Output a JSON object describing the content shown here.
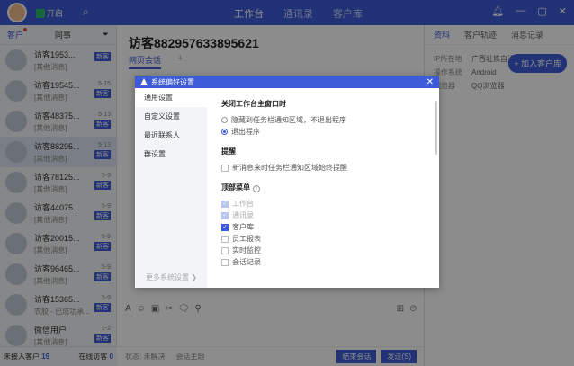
{
  "topbar": {
    "status": "开启",
    "nav": [
      "工作台",
      "通讯录",
      "客户库"
    ],
    "controls": [
      "—",
      "▢",
      "✕"
    ]
  },
  "left": {
    "tabs": [
      "客户",
      "同事"
    ],
    "conversations": [
      {
        "name": "访客1953...",
        "sub": "[其他消息]",
        "date": "",
        "badge": "新客"
      },
      {
        "name": "访客19545...",
        "sub": "[其他消息]",
        "date": "5-15",
        "badge": "新客"
      },
      {
        "name": "访客48375...",
        "sub": "[其他消息]",
        "date": "5-13",
        "badge": "新客"
      },
      {
        "name": "访客88295...",
        "sub": "[其他消息]",
        "date": "5-13",
        "badge": "新客"
      },
      {
        "name": "访客78125...",
        "sub": "[其他消息]",
        "date": "5-9",
        "badge": "新客"
      },
      {
        "name": "访客44075...",
        "sub": "[其他消息]",
        "date": "5-9",
        "badge": "新客"
      },
      {
        "name": "访客20015...",
        "sub": "[其他消息]",
        "date": "5-9",
        "badge": "新客"
      },
      {
        "name": "访客96465...",
        "sub": "[其他消息]",
        "date": "5-9",
        "badge": "新客"
      },
      {
        "name": "访客15365...",
        "sub": "农胶 - 已成功承...",
        "date": "5-9",
        "badge": "新客"
      },
      {
        "name": "微信用户",
        "sub": "[其他消息]",
        "date": "1-2",
        "badge": "新客"
      }
    ],
    "footer": {
      "unaccepted_label": "未接入客户",
      "unaccepted_count": "19",
      "online_label": "在线访客",
      "online_count": "0"
    }
  },
  "center": {
    "title": "访客882957633895621",
    "tab": "网页会话",
    "plus": "+",
    "toolbar": [
      "A",
      "☺",
      "▣",
      "✂",
      "🗨",
      "⚲"
    ],
    "toolbar_right": [
      "⊞",
      "⏲"
    ],
    "footer": {
      "status": "状态: 未解决",
      "topic": "会话主题",
      "end_btn": "结束会话",
      "send_btn": "发送(S)"
    }
  },
  "right": {
    "tabs": [
      "资料",
      "客户轨迹",
      "消息记录"
    ],
    "add_button": "+ 加入客户库",
    "info": [
      {
        "k": "IP所在地",
        "v": "广西壮族自治..."
      },
      {
        "k": "操作系统",
        "v": "Android"
      },
      {
        "k": "浏览器",
        "v": "QQ浏览器"
      }
    ]
  },
  "dialog": {
    "title": "系统偏好设置",
    "close": "✕",
    "side": [
      "通用设置",
      "自定义设置",
      "最近联系人",
      "群设置"
    ],
    "more": "更多系统设置 ❯",
    "sections": {
      "close_title": "关闭工作台主窗口时",
      "close_opt1": "隐藏到任务栏通知区域，不退出程序",
      "close_opt2": "退出程序",
      "remind_title": "提醒",
      "remind_opt": "新消息来时任务栏通知区域始终提醒",
      "menu_title": "顶部菜单",
      "menu_items": [
        {
          "label": "工作台",
          "state": "disabled"
        },
        {
          "label": "通讯录",
          "state": "disabled"
        },
        {
          "label": "客户库",
          "state": "on"
        },
        {
          "label": "员工报表",
          "state": "off"
        },
        {
          "label": "实时监控",
          "state": "off"
        },
        {
          "label": "会话记录",
          "state": "off"
        }
      ]
    }
  }
}
